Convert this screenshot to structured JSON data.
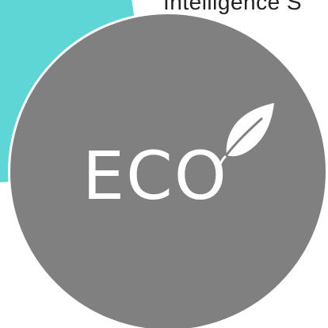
{
  "caption": {
    "text": "Intelligence S"
  },
  "badge": {
    "label": "ECO",
    "icon": "leaf-icon"
  },
  "colors": {
    "teal": "#5fd6d6",
    "badge": "#808080",
    "text": "#ffffff"
  }
}
